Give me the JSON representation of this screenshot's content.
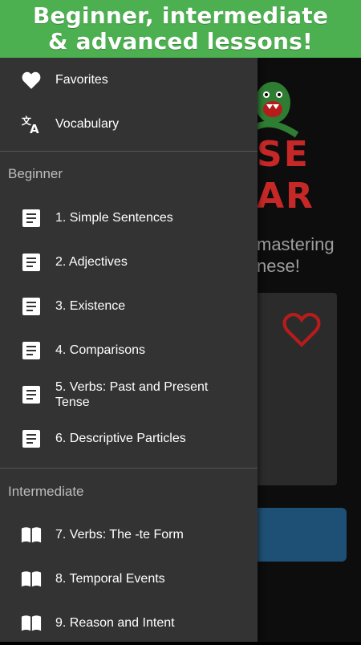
{
  "banner": {
    "line1": "Beginner, intermediate",
    "line2": "& advanced lessons!"
  },
  "background": {
    "logo_line1": "SE",
    "logo_line2": "AR",
    "tagline_line1": "mastering",
    "tagline_line2": "nese!"
  },
  "drawer": {
    "top_items": [
      {
        "label": "Favorites",
        "icon": "heart-icon"
      },
      {
        "label": "Vocabulary",
        "icon": "translate-icon"
      }
    ],
    "beginner": {
      "header": "Beginner",
      "items": [
        {
          "label": "1. Simple Sentences",
          "icon": "document-icon"
        },
        {
          "label": "2. Adjectives",
          "icon": "document-icon"
        },
        {
          "label": "3. Existence",
          "icon": "document-icon"
        },
        {
          "label": "4. Comparisons",
          "icon": "document-icon"
        },
        {
          "label": "5. Verbs: Past and Present Tense",
          "icon": "document-icon"
        },
        {
          "label": "6. Descriptive Particles",
          "icon": "document-icon"
        }
      ]
    },
    "intermediate": {
      "header": "Intermediate",
      "items": [
        {
          "label": "7. Verbs: The -te Form",
          "icon": "book-icon"
        },
        {
          "label": "8. Temporal Events",
          "icon": "book-icon"
        },
        {
          "label": "9. Reason and Intent",
          "icon": "book-icon"
        }
      ]
    }
  },
  "colors": {
    "banner": "#4caf50",
    "drawer": "#333333",
    "accent_red": "#c62828",
    "button_blue": "#1e4f74"
  }
}
